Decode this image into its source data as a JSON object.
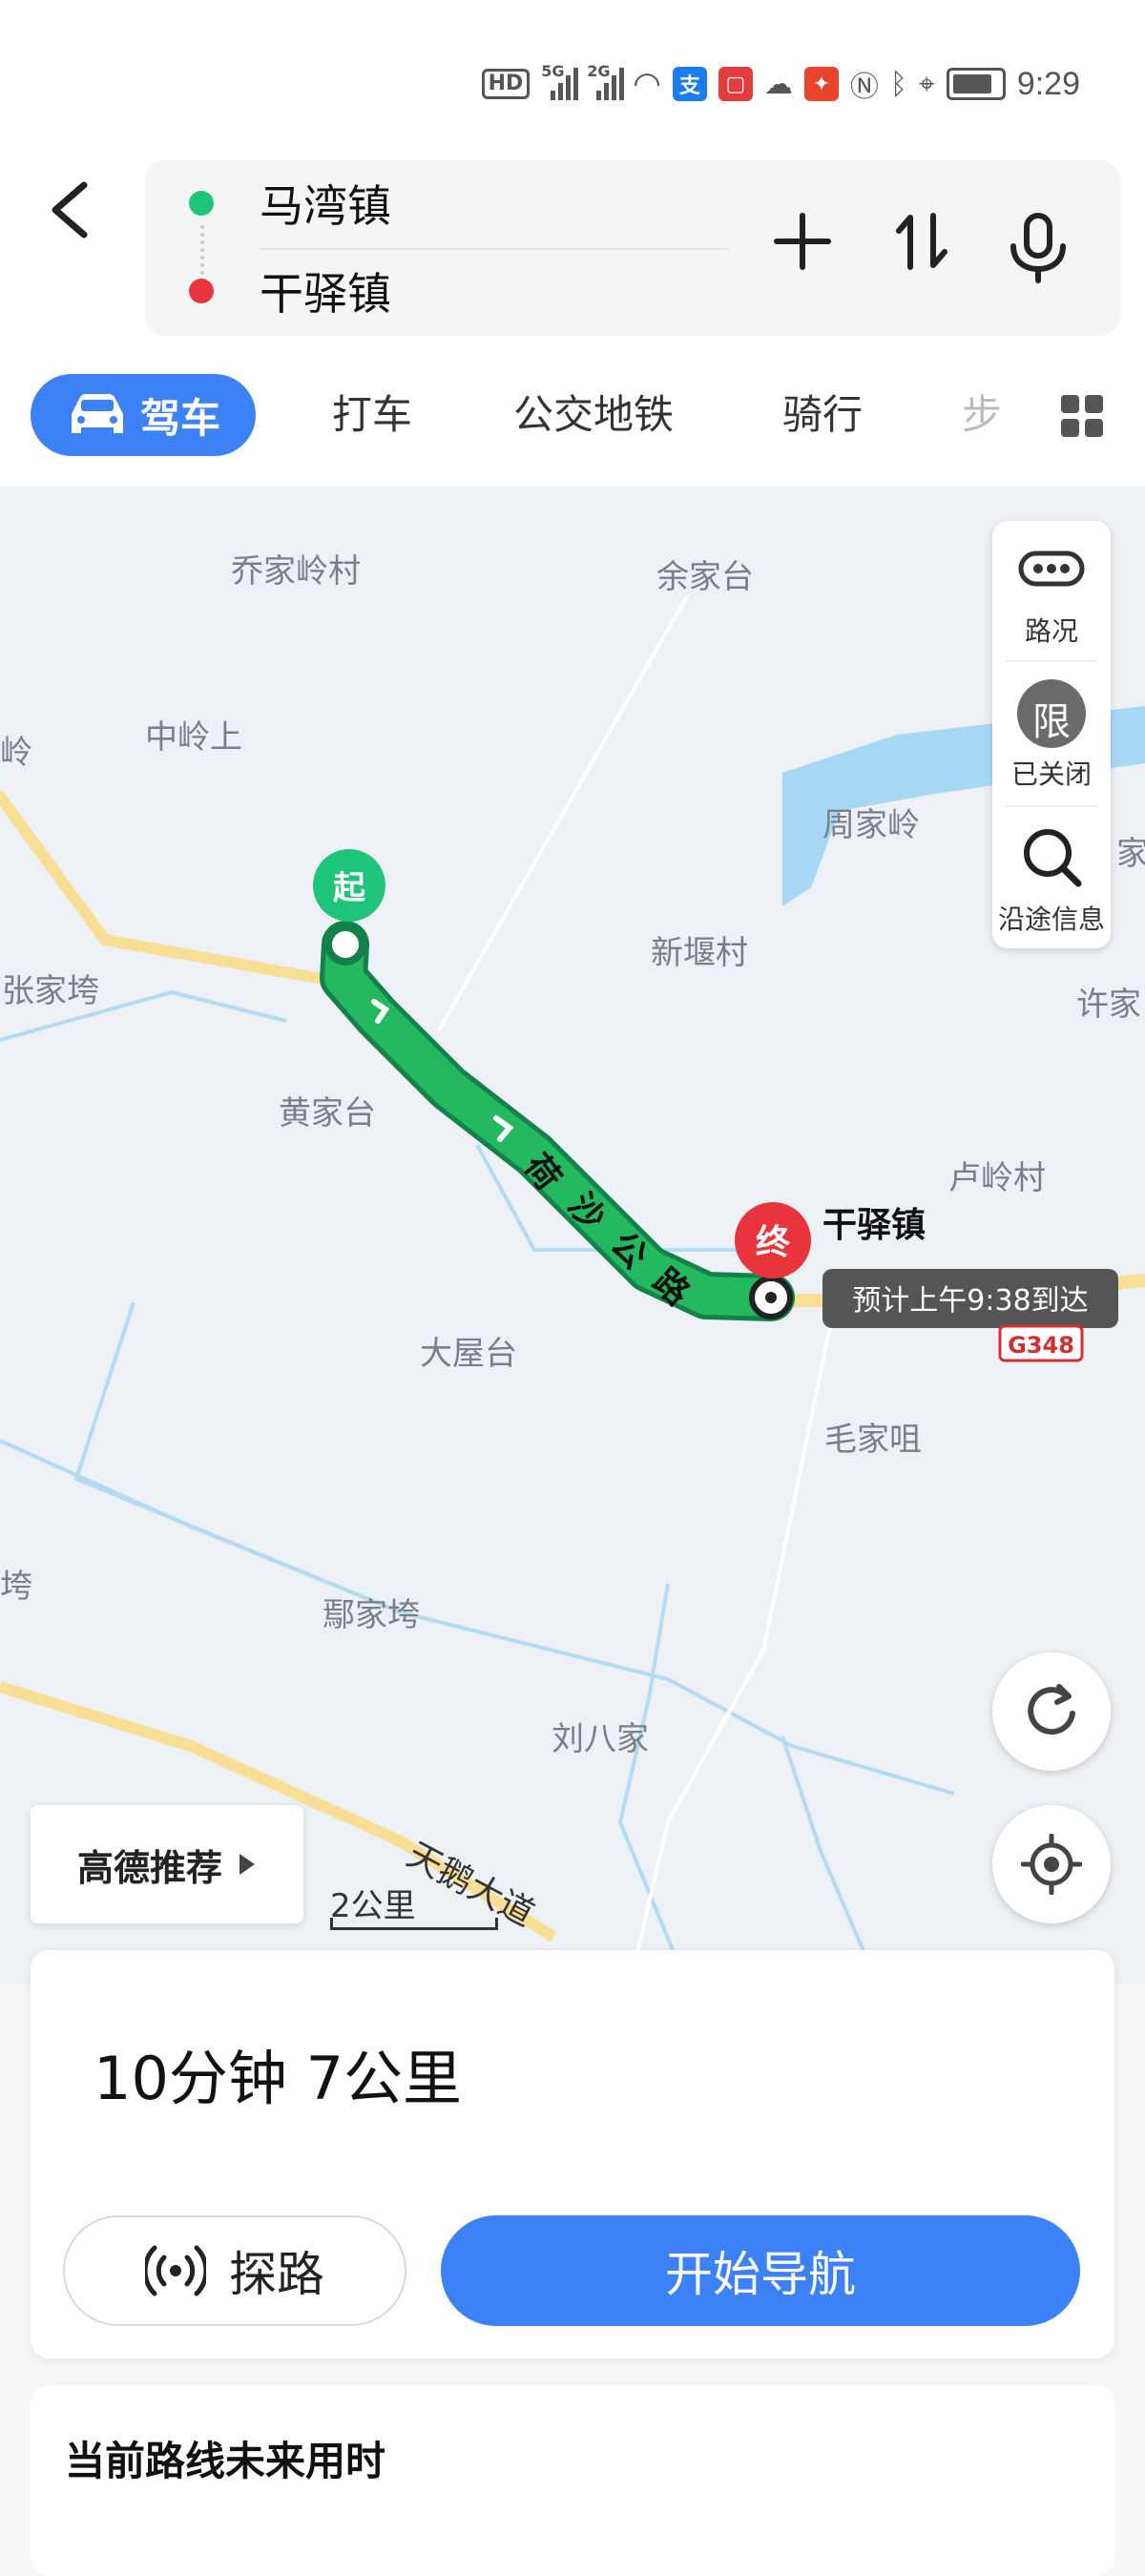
{
  "status_bar": {
    "hd": "HD",
    "net1": "5G",
    "net2": "2G",
    "time": "9:29"
  },
  "header": {
    "from": "马湾镇",
    "to": "干驿镇"
  },
  "tabs": [
    {
      "label": "驾车",
      "active": true
    },
    {
      "label": "打车"
    },
    {
      "label": "公交地铁"
    },
    {
      "label": "骑行"
    },
    {
      "label": "步"
    }
  ],
  "map": {
    "labels": [
      "乔家岭村",
      "余家台",
      "中岭上",
      "周家岭",
      "新堰村",
      "张家垮",
      "许家",
      "黄家台",
      "卢岭村",
      "大屋台",
      "毛家咀",
      "鄢家垮",
      "刘八家",
      "垮",
      "岭",
      "家"
    ],
    "route_name": [
      "荷",
      "沙",
      "公",
      "路"
    ],
    "start_marker": "起",
    "end_marker": "终",
    "destination_label": "干驿镇",
    "eta": "预计上午9:38到达",
    "road_badge": "G348",
    "road_text": "天鹅大道",
    "controls": [
      {
        "label": "路况",
        "icon": "traffic-icon"
      },
      {
        "label": "已关闭",
        "icon": "restriction-icon",
        "glyph": "限"
      },
      {
        "label": "沿途信息",
        "icon": "search-icon"
      }
    ],
    "recommend_label": "高德推荐",
    "scale_label": "2公里"
  },
  "sheet": {
    "summary": "10分钟  7公里",
    "probe_label": "探路",
    "nav_label": "开始导航"
  },
  "future": {
    "title": "当前路线未来用时"
  },
  "colors": {
    "accent": "#3c82f6",
    "route": "#1fae5b",
    "start": "#1ec47a",
    "end": "#e8343c"
  }
}
